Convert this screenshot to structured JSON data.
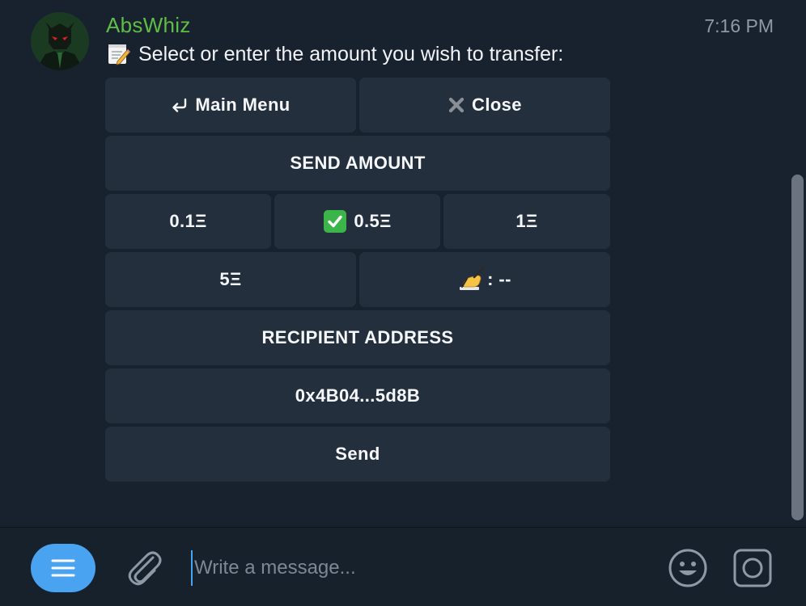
{
  "message": {
    "sender": "AbsWhiz",
    "time": "7:16 PM",
    "text": "Select or enter the amount you wish to transfer:",
    "text_icon": "memo-icon"
  },
  "keyboard": {
    "main_menu": {
      "label": "Main Menu",
      "icon": "return-arrow-icon"
    },
    "close": {
      "label": "Close",
      "icon": "close-x-icon"
    },
    "send_amount_header": {
      "label": "SEND AMOUNT"
    },
    "amounts": [
      {
        "label": "0.1Ξ",
        "selected": false
      },
      {
        "label": "0.5Ξ",
        "selected": true,
        "icon": "checkmark-icon"
      },
      {
        "label": "1Ξ",
        "selected": false
      }
    ],
    "amount_5": {
      "label": "5Ξ"
    },
    "custom_amount": {
      "label": ": --",
      "icon": "writing-hand-icon"
    },
    "recipient_header": {
      "label": "RECIPIENT ADDRESS"
    },
    "recipient_address": {
      "label": "0x4B04...5d8B"
    },
    "send": {
      "label": "Send"
    }
  },
  "composer": {
    "placeholder": "Write a message...",
    "value": ""
  },
  "colors": {
    "background": "#18212e",
    "button": "#242f3d",
    "sender_name": "#5fbd45",
    "accent": "#4aa3f0",
    "check_green": "#3bb54a"
  }
}
